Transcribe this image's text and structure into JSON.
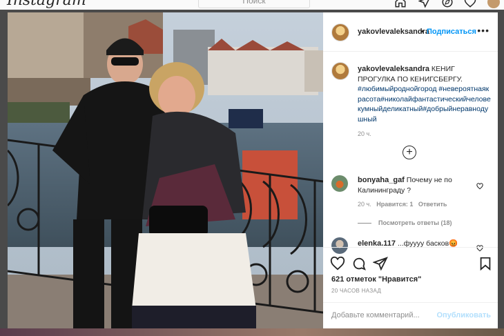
{
  "topbar": {
    "logo": "Instagram",
    "search_placeholder": "Поиск",
    "icons": [
      "home-icon",
      "direct-icon",
      "explore-icon",
      "heart-icon",
      "profile-avatar"
    ]
  },
  "post": {
    "username": "yakovlevaleksandra",
    "follow_separator": "•",
    "follow_label": "Подписаться",
    "more_label": "•••",
    "caption_user": "yakovlevaleksandra",
    "caption_text": "КЕНИГ ПРОГУЛКА ПО КЕНИГСБЕРГУ.",
    "caption_tags": "#любимыйроднойгород #невероятнаякрасота#николайфантастическийчеловекумныйделикатный#добрыйнеравнодушный",
    "caption_time": "20 ч.",
    "load_more_icon": "plus-circle-icon",
    "comments": [
      {
        "user": "bonyaha_gaf",
        "text": "Почему не по Калининграду ?",
        "time": "20 ч.",
        "likes": "Нравится: 1",
        "reply": "Ответить",
        "view_replies": "Посмотреть ответы (18)"
      },
      {
        "user": "elenka.117",
        "text": "...фуууу басков😡"
      }
    ],
    "likes_text": "621 отметок \"Нравится\"",
    "time_text": "20 ЧАСОВ НАЗАД",
    "add_comment_placeholder": "Добавьте комментарий...",
    "publish_label": "Опубликовать"
  },
  "colors": {
    "link_blue": "#0095f6",
    "hashtag": "#00376b",
    "muted": "#8e8e8e",
    "text": "#262626"
  }
}
